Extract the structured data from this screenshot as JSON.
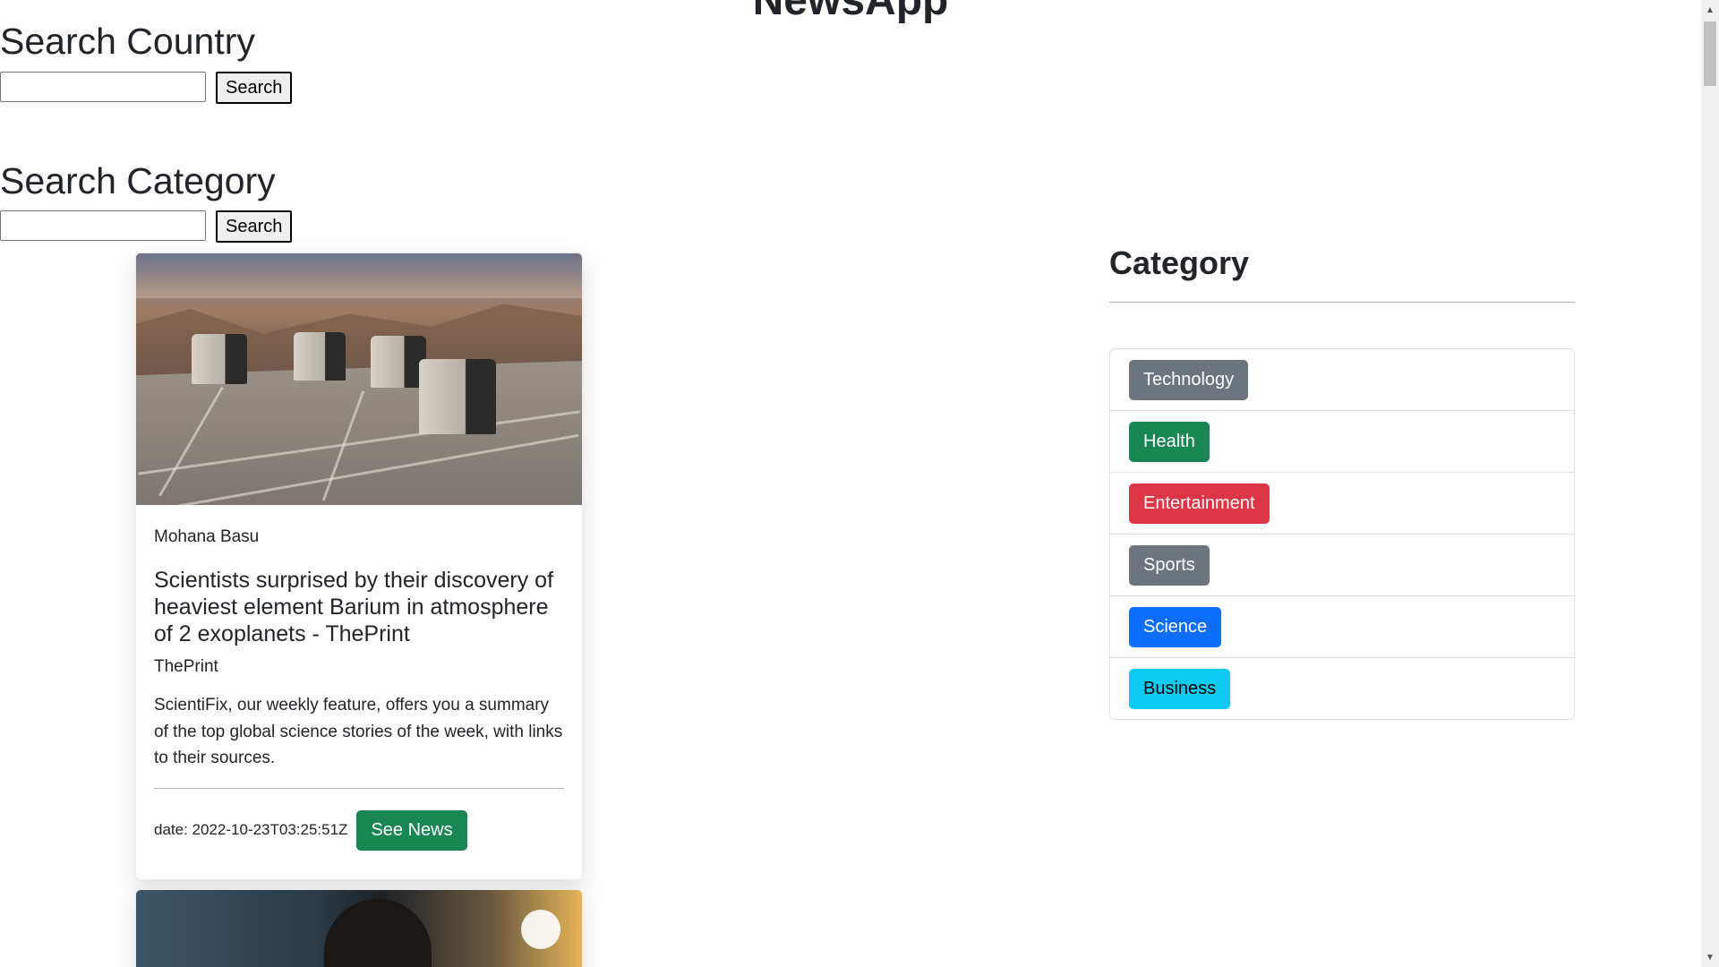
{
  "app": {
    "title": "NewsApp"
  },
  "search_country": {
    "heading": "Search Country",
    "input_value": "",
    "button_label": "Search"
  },
  "search_category": {
    "heading": "Search Category",
    "input_value": "",
    "button_label": "Search"
  },
  "articles": [
    {
      "author": "Mohana Basu",
      "title": "Scientists surprised by their discovery of heaviest element Barium in atmosphere of 2 exoplanets - ThePrint",
      "source": "ThePrint",
      "description": "ScientiFix, our weekly feature, offers you a summary of the top global science stories of the week, with links to their sources.",
      "date": "date: 2022-10-23T03:25:51Z",
      "button_label": "See News"
    }
  ],
  "category_panel": {
    "title": "Category",
    "items": [
      {
        "label": "Technology",
        "color": "#6c757d"
      },
      {
        "label": "Health",
        "color": "#198754"
      },
      {
        "label": "Entertainment",
        "color": "#dc3545"
      },
      {
        "label": "Sports",
        "color": "#6c757d"
      },
      {
        "label": "Science",
        "color": "#0d6efd"
      },
      {
        "label": "Business",
        "color": "#0dcaf0"
      }
    ]
  },
  "scrollbar": {
    "up_arrow_icon": "triangle-up-icon",
    "down_arrow_icon": "triangle-down-icon"
  }
}
